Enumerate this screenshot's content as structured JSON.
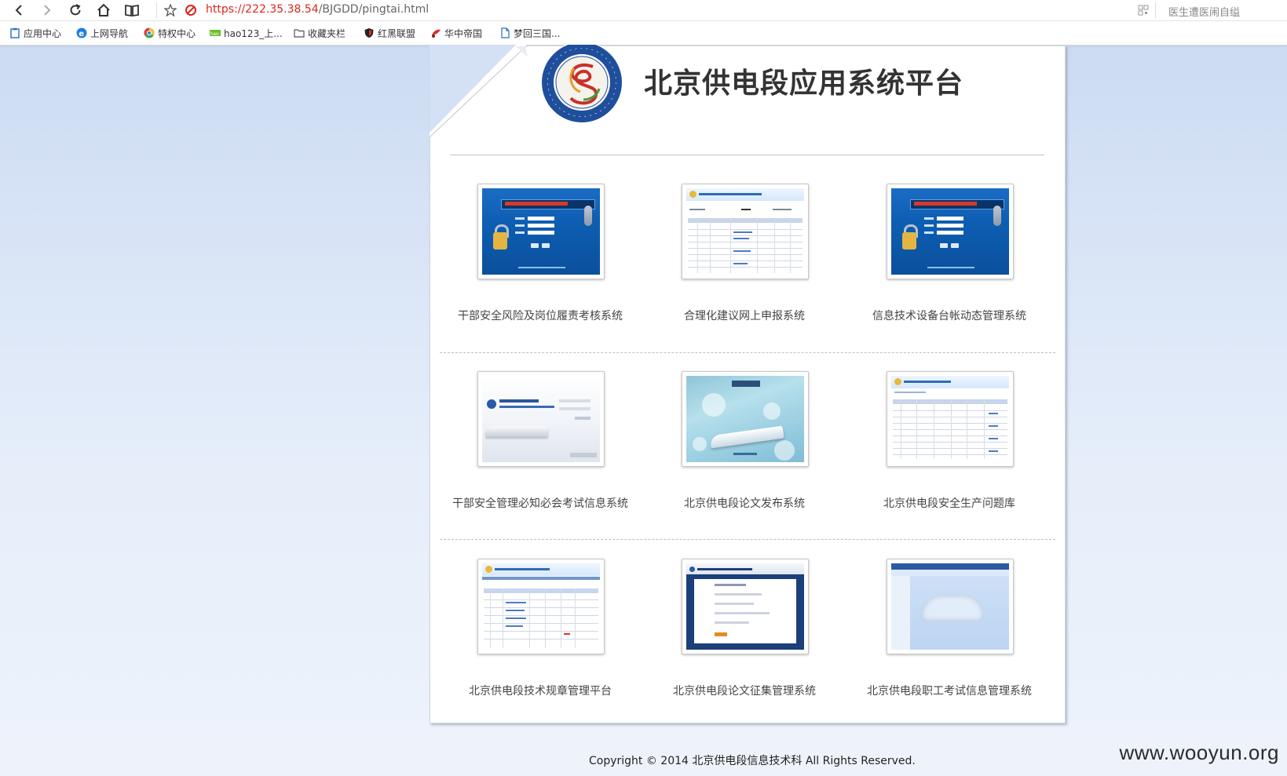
{
  "browser": {
    "url_scheme_host": "https://222.35.38.54",
    "url_path": "/BJGDD/pingtai.html",
    "right_text": "医生遭医闹自缢"
  },
  "bookmarks": [
    {
      "label": "应用中心",
      "icon": "clipboard-icon"
    },
    {
      "label": "上网导航",
      "icon": "ie-icon"
    },
    {
      "label": "特权中心",
      "icon": "chrome-icon"
    },
    {
      "label": "hao123_上...",
      "icon": "hao123-icon"
    },
    {
      "label": "收藏夹栏",
      "icon": "folder-icon"
    },
    {
      "label": "红黑联盟",
      "icon": "shield-icon"
    },
    {
      "label": "华中帝国",
      "icon": "flag-icon"
    },
    {
      "label": "梦回三国...",
      "icon": "page-icon"
    }
  ],
  "header": {
    "title": "北京供电段应用系统平台"
  },
  "systems": [
    {
      "label": "干部安全风险及岗位履责考核系统",
      "thumb": "login"
    },
    {
      "label": "合理化建议网上申报系统",
      "thumb": "table"
    },
    {
      "label": "信息技术设备台帐动态管理系统",
      "thumb": "login"
    },
    {
      "label": "干部安全管理必知必会考试信息系统",
      "thumb": "welcome"
    },
    {
      "label": "北京供电段论文发布系统",
      "thumb": "cover"
    },
    {
      "label": "北京供电段安全生产问题库",
      "thumb": "table"
    },
    {
      "label": "北京供电段技术规章管理平台",
      "thumb": "table"
    },
    {
      "label": "北京供电段论文征集管理系统",
      "thumb": "form"
    },
    {
      "label": "北京供电段职工考试信息管理系统",
      "thumb": "ghost"
    }
  ],
  "footer": {
    "copyright": "Copyright © 2014 北京供电段信息技术科 All Rights Reserved."
  },
  "watermark": "www.wooyun.org",
  "colors": {
    "url_red": "#e0251b",
    "page_bg": "#d8e4f6",
    "login_blue": "#0d5eb2"
  }
}
